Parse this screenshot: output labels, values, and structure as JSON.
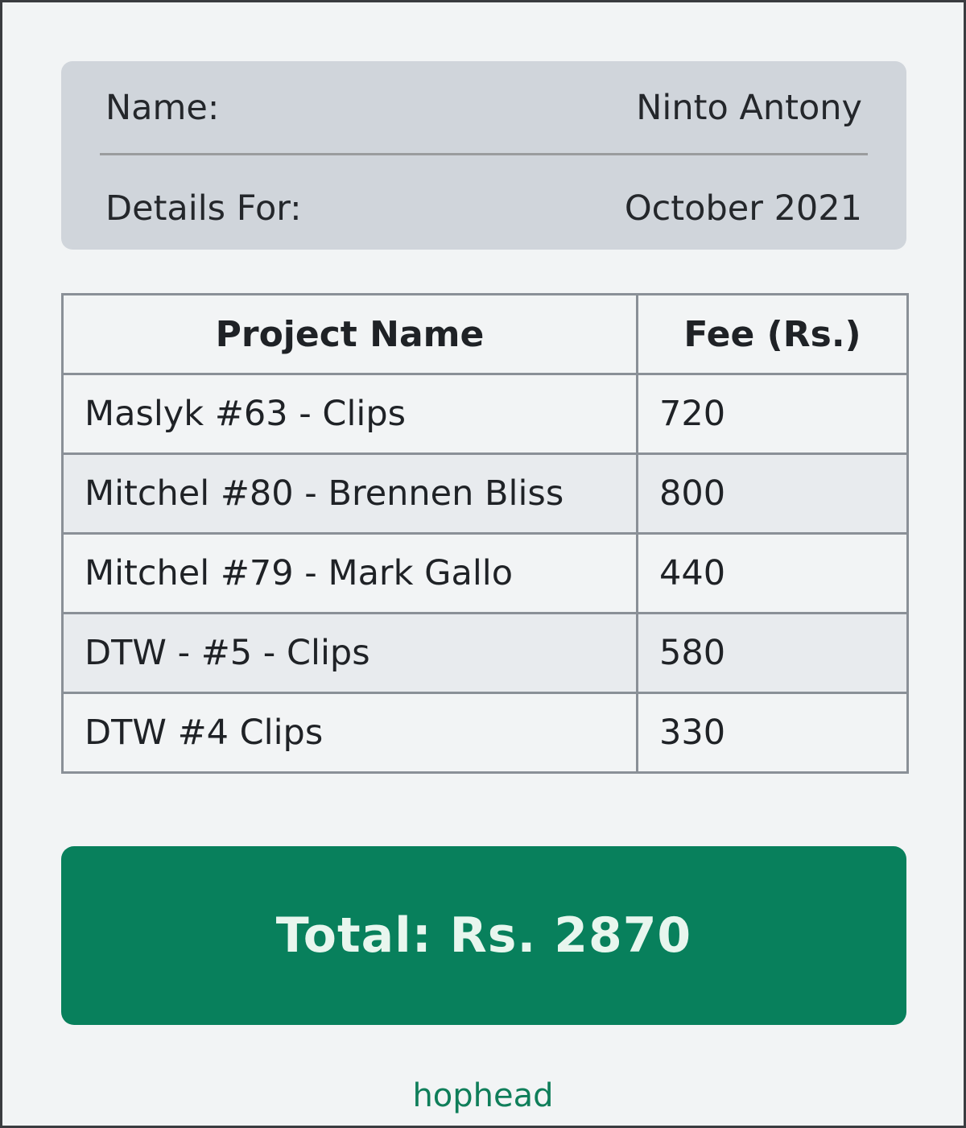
{
  "info": {
    "name_label": "Name:",
    "name_value": "Ninto Antony",
    "period_label": "Details For:",
    "period_value": "October 2021"
  },
  "table": {
    "headers": [
      "Project Name",
      "Fee (Rs.)"
    ],
    "rows": [
      {
        "project": "Maslyk #63 - Clips",
        "fee": "720"
      },
      {
        "project": "Mitchel #80 - Brennen Bliss",
        "fee": "800"
      },
      {
        "project": "Mitchel #79 - Mark Gallo",
        "fee": "440"
      },
      {
        "project": "DTW - #5 - Clips",
        "fee": "580"
      },
      {
        "project": "DTW #4 Clips",
        "fee": "330"
      }
    ]
  },
  "total": {
    "text": "Total: Rs. 2870"
  },
  "footer": {
    "brand": "hophead"
  },
  "colors": {
    "accent": "#08805c",
    "card": "#d0d5db",
    "background": "#f2f4f5"
  }
}
